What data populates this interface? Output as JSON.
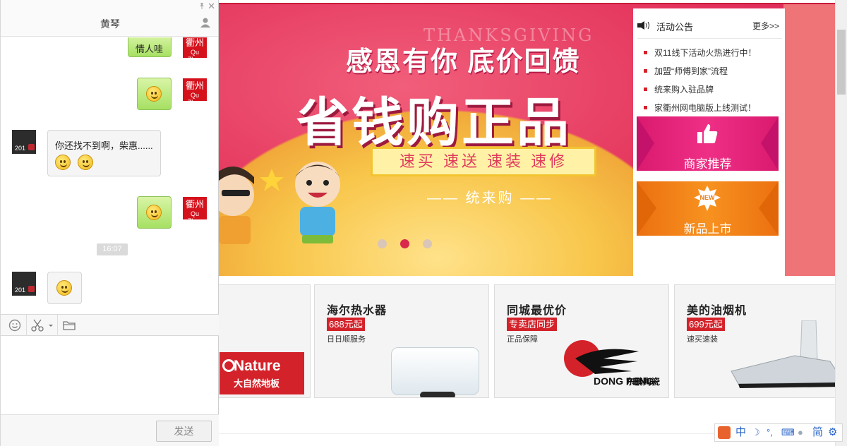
{
  "chat": {
    "title": "黄琴",
    "close_glyph": "✕",
    "messages": [
      {
        "side": "right",
        "text": "情人哇"
      },
      {
        "side": "right",
        "type": "emoji",
        "emoji": "grin"
      },
      {
        "side": "left",
        "text": "你还找不到啊，柴惠......",
        "emojis": [
          "thinking",
          "thinking"
        ]
      },
      {
        "side": "right",
        "type": "emoji",
        "emoji": "tongue"
      },
      {
        "side": "left",
        "type": "emoji",
        "emoji": "smile"
      }
    ],
    "time_stamp": "16:07",
    "avatar_me": {
      "line1": "衢州",
      "line2": "Qu Zhou"
    },
    "avatar_other": {
      "line1": "201",
      "line2": "5"
    },
    "toolbar": [
      "emoji-icon",
      "scissors-icon",
      "folder-icon"
    ],
    "send_label": "发送"
  },
  "banner": {
    "ghost_text": "THANKSGIVING",
    "line1": "感恩有你 底价回馈",
    "line2": "省钱购正品",
    "ribbon": "速买 速送 速装 速修",
    "brand": "—— 统来购 ——",
    "dots": 3,
    "active_dot": 1
  },
  "notice": {
    "title": "活动公告",
    "more": "更多>>",
    "items": [
      "双11线下活动火热进行中！",
      "加盟“师傅到家”流程",
      "统来购入驻品牌",
      "家衢州网电脑版上线测试！"
    ],
    "promo1": {
      "label": "商家推荐",
      "color": "#e7247f"
    },
    "promo2": {
      "label": "新品上市",
      "badge": "NEW",
      "color": "#f08014"
    }
  },
  "products": [
    {
      "title": "",
      "tag": "",
      "sub": "",
      "brand": "Nature",
      "brand_sub": "大自然地板"
    },
    {
      "title": "海尔热水器",
      "tag": "688元起",
      "sub": "日日顺服务"
    },
    {
      "title": "同城最优价",
      "tag": "专卖店同步",
      "sub": "正品保障",
      "brand": "DONG PENG",
      "brand_sub": "东鹏陶瓷"
    },
    {
      "title": "美的油烟机",
      "tag": "699元起",
      "sub": "速买速装"
    }
  ],
  "ime": [
    "中",
    "简"
  ]
}
